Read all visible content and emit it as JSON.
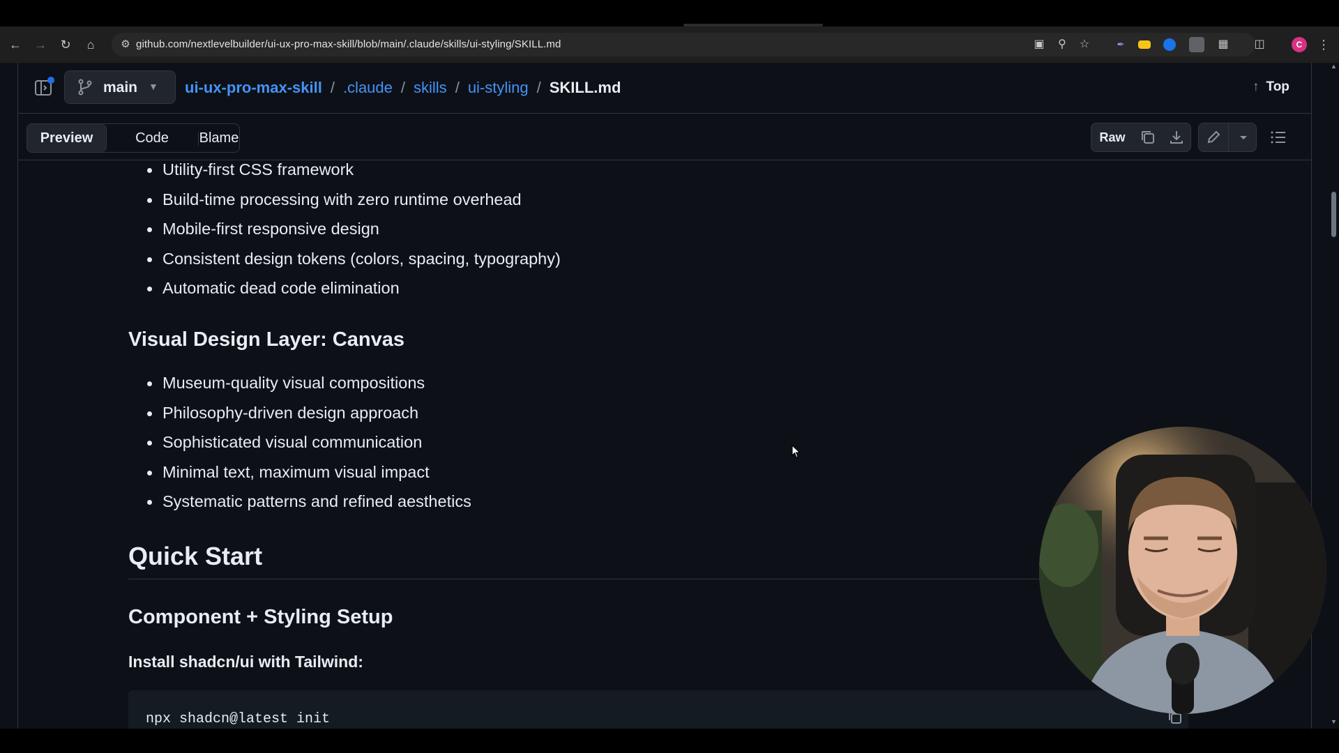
{
  "browser": {
    "url": "github.com/nextlevelbuilder/ui-ux-pro-max-skill/blob/main/.claude/skills/ui-styling/SKILL.md",
    "profile_initial": "C"
  },
  "header": {
    "branch": "main",
    "breadcrumb": {
      "repo": "ui-ux-pro-max-skill",
      "parts": [
        ".claude",
        "skills",
        "ui-styling"
      ],
      "separator": "/",
      "file": "SKILL.md"
    },
    "top_label": "Top"
  },
  "toolbar": {
    "tabs": [
      "Preview",
      "Code",
      "Blame"
    ],
    "active_tab": "Preview",
    "raw_label": "Raw"
  },
  "content": {
    "list1": [
      "Utility-first CSS framework",
      "Build-time processing with zero runtime overhead",
      "Mobile-first responsive design",
      "Consistent design tokens (colors, spacing, typography)",
      "Automatic dead code elimination"
    ],
    "heading_canvas": "Visual Design Layer: Canvas",
    "list2": [
      "Museum-quality visual compositions",
      "Philosophy-driven design approach",
      "Sophisticated visual communication",
      "Minimal text, maximum visual impact",
      "Systematic patterns and refined aesthetics"
    ],
    "heading_quickstart": "Quick Start",
    "heading_setup": "Component + Styling Setup",
    "install_label": "Install shadcn/ui with Tailwind:",
    "code": "npx shadcn@latest init"
  },
  "colors": {
    "page_bg": "#0d1117",
    "text": "#e6edf3",
    "link": "#4493f8",
    "border": "#30363d",
    "muted": "#8b949e"
  }
}
